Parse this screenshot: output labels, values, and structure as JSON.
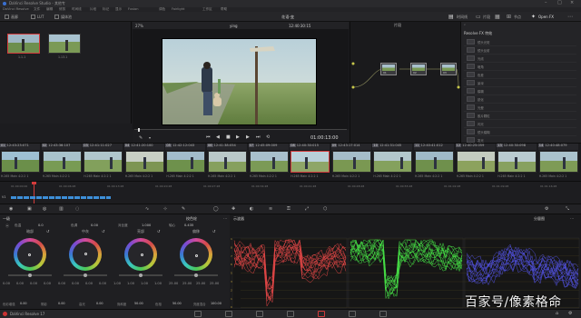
{
  "app": {
    "title": "DaVinci Resolve Studio - 其他专",
    "version_label": "DaVinci Resolve 17"
  },
  "menu": [
    "DaVinci Resolve",
    "文件",
    "编辑",
    "修剪",
    "时间线",
    "片段",
    "标记",
    "显示",
    "Fusion",
    "调色",
    "Fairlight",
    "工作区",
    "帮助"
  ],
  "toolbar": {
    "gallery_tab": "画廊",
    "lut_tab": "LUT",
    "media_tab": "媒体池",
    "project_name": "花语-变",
    "timeline_btn": "时间线",
    "clips_btn": "片段",
    "nodes_btn": "节点",
    "openfx_btn": "Open FX",
    "lightbox_btn": "光箱"
  },
  "gallery": {
    "stills": [
      {
        "label": "1.1.1"
      },
      {
        "label": "1.13.1"
      }
    ]
  },
  "viewer": {
    "zoom": "27%",
    "clip_name": "ying",
    "timecode_top": "12:40:30:15",
    "timecode_main": "01:00:13:00",
    "node_mode": "片段"
  },
  "fx": {
    "header": "Resolve FX 特效",
    "items": [
      "镜头光斑",
      "镜头反射",
      "光线",
      "暗角",
      "色差",
      "景深",
      "模糊",
      "锐化",
      "光晕",
      "胶片颗粒",
      "闪光",
      "镜头模糊",
      "发光"
    ]
  },
  "nodes": {
    "labels": [
      "01",
      "02",
      "03"
    ]
  },
  "clips": [
    {
      "num": "01",
      "tc": "12:43:23:071",
      "track": "V1",
      "codec": "H.265 Main 4:2:2 1"
    },
    {
      "num": "02",
      "tc": "12:43:36:107",
      "track": "V1",
      "codec": "H.265 Main 4:2:2 1"
    },
    {
      "num": "03",
      "tc": "12:41:11:027",
      "track": "V1",
      "codec": "H.265 Main 4:2:2 1"
    },
    {
      "num": "04",
      "tc": "12:41:20:100",
      "track": "V1",
      "codec": "H.265 Main 4:2:2 1"
    },
    {
      "num": "05",
      "tc": "12:42:12:043",
      "track": "V1",
      "codec": "H.265 Main 4:2:2 1"
    },
    {
      "num": "06",
      "tc": "12:41:38:054",
      "track": "V1",
      "codec": "H.265 Main 4:2:2 1"
    },
    {
      "num": "07",
      "tc": "12:45:09:009",
      "track": "V1",
      "codec": "H.265 Main 4:2:2 1"
    },
    {
      "num": "08",
      "tc": "12:40:30:015",
      "track": "V1",
      "codec": "H.265 Main 4:2:2 1"
    },
    {
      "num": "09",
      "tc": "12:43:17:014",
      "track": "V1",
      "codec": "H.265 Main 4:2:2 1"
    },
    {
      "num": "10",
      "tc": "12:41:31:045",
      "track": "V1",
      "codec": "H.265 Main 4:2:2 1"
    },
    {
      "num": "11",
      "tc": "12:40:41:012",
      "track": "V1",
      "codec": "H.265 Main 4:2:2 1"
    },
    {
      "num": "12",
      "tc": "12:40:25:059",
      "track": "V1",
      "codec": "H.265 Main 4:2:2 1"
    },
    {
      "num": "13",
      "tc": "12:40:30:098",
      "track": "V1",
      "codec": "H.265 Main 4:2:2 1"
    },
    {
      "num": "14",
      "tc": "12:40:48:079",
      "track": "V1",
      "codec": "H.265 Main 4:2:2 1"
    }
  ],
  "minitl": {
    "ticks": [
      "01:00:00:00",
      "01:00:06:28",
      "01:00:13:28",
      "01:00:20:28",
      "01:00:27:28",
      "01:00:34:28",
      "01:00:41:28",
      "01:00:48:28",
      "01:00:55:28",
      "01:01:02:28",
      "01:01:09:28",
      "01:01:16:28"
    ]
  },
  "wheels": {
    "mode_label": "一级",
    "mode_btn": "校色轮",
    "temp_label": "色温",
    "temp_val": "0.0",
    "tint_label": "色调",
    "tint_val": "0.00",
    "contrast_label": "对比度",
    "contrast_val": "1.000",
    "pivot_label": "轴心",
    "pivot_val": "0.435",
    "detail_label": "中间调细节",
    "detail_val": "0.00",
    "items": [
      {
        "name": "暗部",
        "vals": [
          "0.00",
          "0.00",
          "0.00",
          "0.00"
        ]
      },
      {
        "name": "中灰",
        "vals": [
          "0.00",
          "0.00",
          "0.00",
          "0.00"
        ]
      },
      {
        "name": "亮部",
        "vals": [
          "1.00",
          "1.00",
          "1.00",
          "1.00"
        ]
      },
      {
        "name": "偏移",
        "vals": [
          "25.00",
          "25.00",
          "25.00",
          "25.00"
        ]
      }
    ],
    "footer": [
      {
        "label": "色彩增强",
        "val": "0.00"
      },
      {
        "label": "阴影",
        "val": "0.00"
      },
      {
        "label": "高光",
        "val": "0.00"
      },
      {
        "label": "饱和度",
        "val": "50.00"
      },
      {
        "label": "色相",
        "val": "50.00"
      },
      {
        "label": "亮度混合",
        "val": "100.00"
      }
    ]
  },
  "scopes": {
    "title": "示波器",
    "mode": "分量图",
    "scale": [
      "1023",
      "896",
      "768",
      "640",
      "512",
      "384",
      "256",
      "128",
      "0"
    ]
  },
  "watermark": "百家号/像素格命",
  "colors": {
    "accent_red": "#d23b3b",
    "scope_red": "#ff4d4d",
    "scope_green": "#4dff4d",
    "scope_blue": "#5a5aff"
  }
}
